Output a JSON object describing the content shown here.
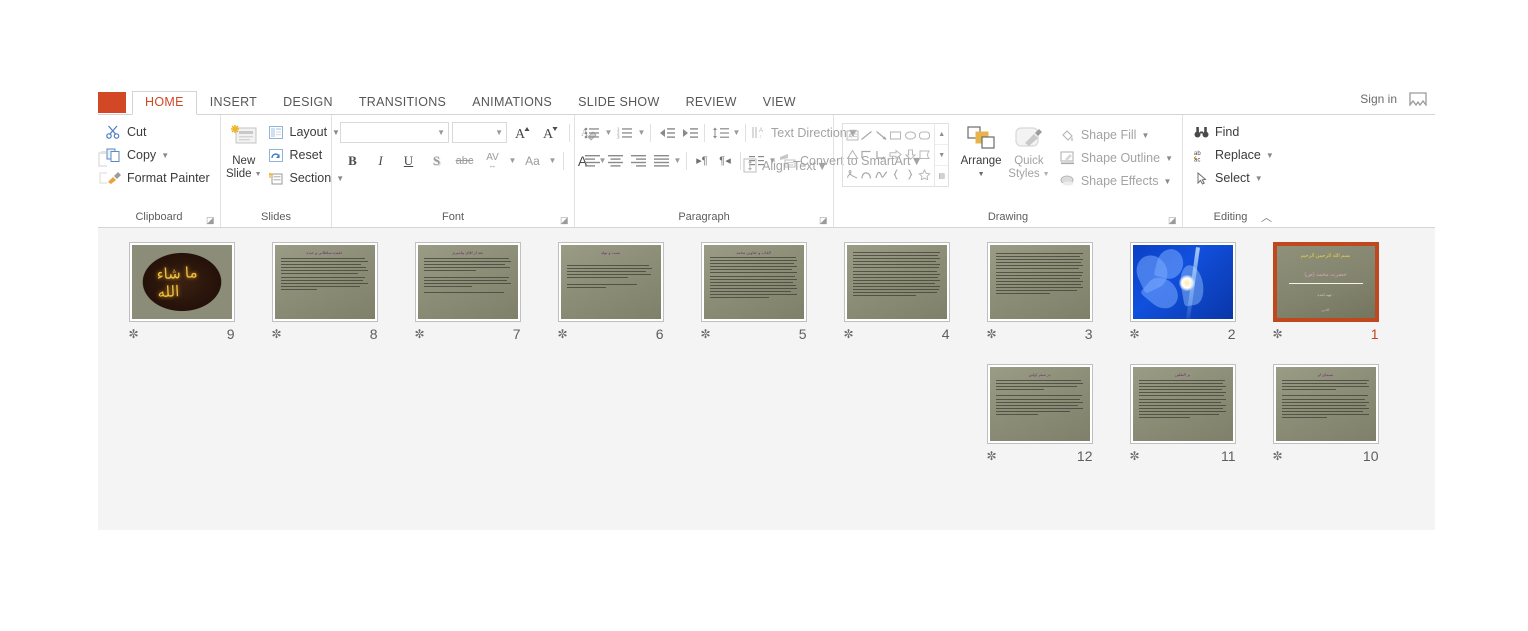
{
  "window": {
    "signin_label": "Sign in"
  },
  "tabs": [
    {
      "label": "HOME",
      "active": true
    },
    {
      "label": "INSERT",
      "active": false
    },
    {
      "label": "DESIGN",
      "active": false
    },
    {
      "label": "TRANSITIONS",
      "active": false
    },
    {
      "label": "ANIMATIONS",
      "active": false
    },
    {
      "label": "SLIDE SHOW",
      "active": false
    },
    {
      "label": "REVIEW",
      "active": false
    },
    {
      "label": "VIEW",
      "active": false
    }
  ],
  "ribbon": {
    "clipboard": {
      "label": "Clipboard",
      "cut": "Cut",
      "copy": "Copy",
      "format_painter": "Format Painter"
    },
    "slides": {
      "label": "Slides",
      "new_slide": "New\nSlide",
      "new_slide_line1": "New",
      "new_slide_line2": "Slide",
      "layout": "Layout",
      "reset": "Reset",
      "section": "Section"
    },
    "font": {
      "label": "Font",
      "font_name_value": "",
      "font_size_value": "",
      "bold": "B",
      "italic": "I",
      "underline": "U",
      "shadow": "S",
      "strikethrough": "abc",
      "character_spacing": "AV",
      "change_case": "Aa",
      "font_color": "A"
    },
    "paragraph": {
      "label": "Paragraph",
      "text_direction": "Text Direction",
      "align_text": "Align Text",
      "convert_to_smartart": "Convert to SmartArt"
    },
    "drawing": {
      "label": "Drawing",
      "arrange": "Arrange",
      "quick_styles_line1": "Quick",
      "quick_styles_line2": "Styles",
      "shape_fill": "Shape Fill",
      "shape_outline": "Shape Outline",
      "shape_effects": "Shape Effects"
    },
    "editing": {
      "label": "Editing",
      "find": "Find",
      "replace": "Replace",
      "select": "Select"
    }
  },
  "slides_panel": {
    "star_glyph": "✼",
    "rows": [
      [
        {
          "number": "9",
          "kind": "logo",
          "title": "",
          "lines": 0,
          "selected": false
        },
        {
          "number": "8",
          "kind": "doc",
          "title": "عقیده سلطانی و عبده",
          "lines": 11,
          "selected": false
        },
        {
          "number": "7",
          "kind": "doc",
          "title": "بعد از اقای پیامبری",
          "lines": 12,
          "selected": false
        },
        {
          "number": "6",
          "kind": "doc",
          "title": "نسب و تولد",
          "lines": 8,
          "selected": false
        },
        {
          "number": "5",
          "kind": "doc",
          "title": "القاب و عناوین محمد",
          "lines": 14,
          "selected": false
        },
        {
          "number": "4",
          "kind": "doc",
          "title": "",
          "lines": 15,
          "selected": false
        },
        {
          "number": "3",
          "kind": "doc",
          "title": "",
          "lines": 14,
          "selected": false
        },
        {
          "number": "2",
          "kind": "flower",
          "title": "",
          "lines": 0,
          "selected": false
        },
        {
          "number": "1",
          "kind": "title",
          "title": "بسم الله الرحمن الرحیم",
          "subtitle": "حضرت محمد (ص)",
          "sub2": "تهیه کننده :",
          "sub3": "کلاس",
          "lines": 0,
          "selected": true
        }
      ],
      [
        {
          "number": "12",
          "kind": "doc",
          "title": "در سفر اولین",
          "lines": 12,
          "selected": false
        },
        {
          "number": "11",
          "kind": "doc",
          "title": "بر الثقلین",
          "lines": 13,
          "selected": false
        },
        {
          "number": "10",
          "kind": "doc",
          "title": "سیمای او",
          "lines": 13,
          "selected": false
        }
      ]
    ]
  },
  "colors": {
    "accent": "#d24726",
    "selection_border": "#c0481f",
    "ribbon_text": "#3b3b3b",
    "disabled_text": "#a3a3a3",
    "panel_bg": "#f4f4f4"
  }
}
